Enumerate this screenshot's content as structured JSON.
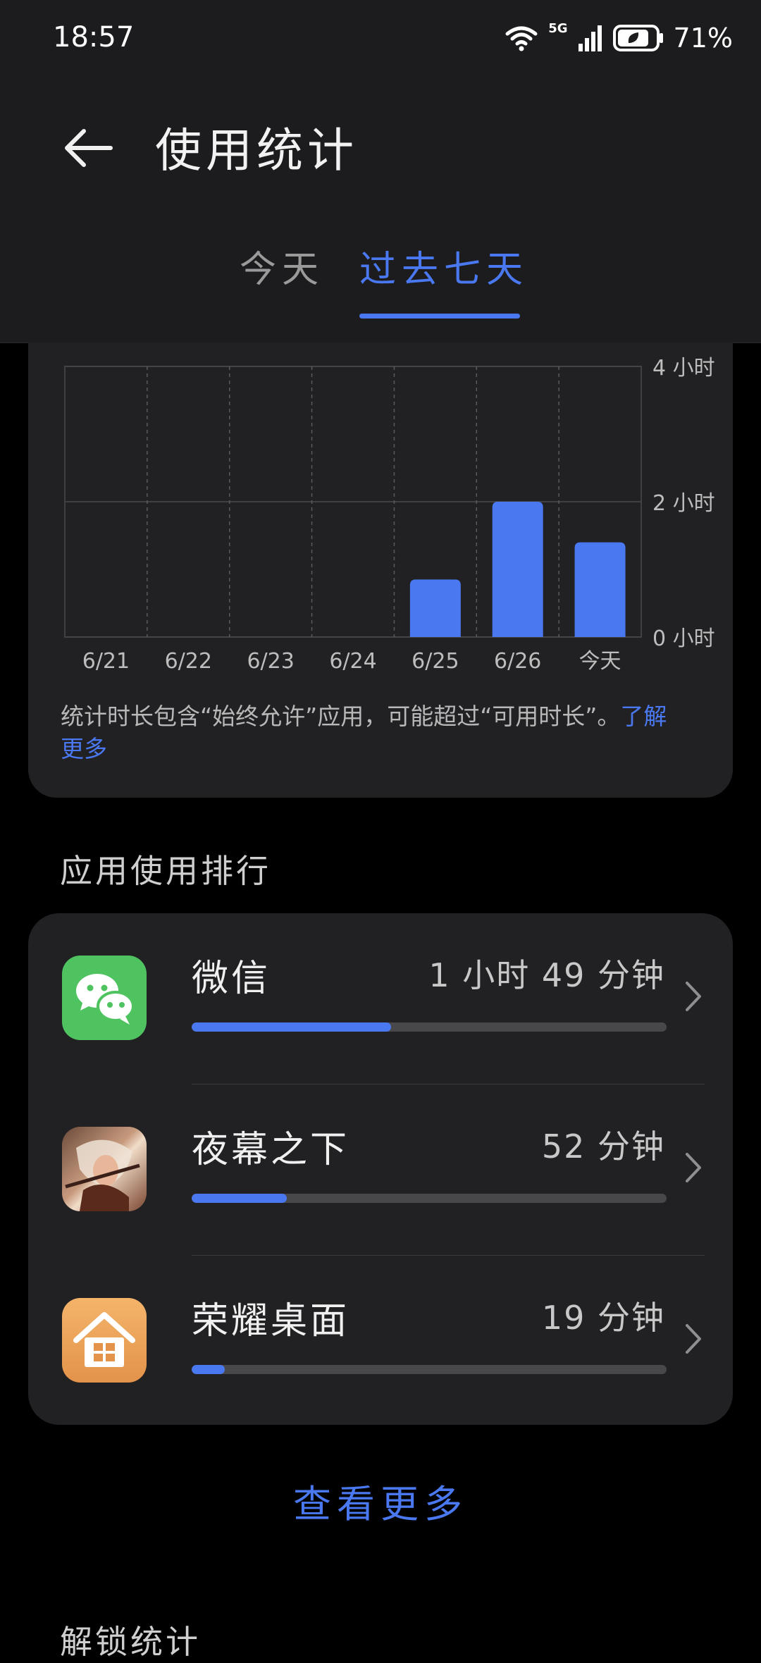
{
  "status_bar": {
    "time": "18:57",
    "network": "5G",
    "battery": "71%"
  },
  "header": {
    "title": "使用统计"
  },
  "tabs": [
    {
      "label": "今天",
      "selected": false
    },
    {
      "label": "过去七天",
      "selected": true
    }
  ],
  "chart_data": {
    "type": "bar",
    "categories": [
      "6/21",
      "6/22",
      "6/23",
      "6/24",
      "6/25",
      "6/26",
      "今天"
    ],
    "values": [
      0,
      0,
      0,
      0,
      0.85,
      2.0,
      1.4
    ],
    "ylim": [
      0,
      4
    ],
    "y_ticks": [
      {
        "value": 0,
        "label": "0 小时"
      },
      {
        "value": 2,
        "label": "2 小时"
      },
      {
        "value": 4,
        "label": "4 小时"
      }
    ],
    "bar_color": "#4a78f0",
    "grid": true
  },
  "note": {
    "text": "统计时长包含“始终允许”应用，可能超过“可用时长”。",
    "link": "了解更多"
  },
  "ranking": {
    "title": "应用使用排行",
    "apps": [
      {
        "name": "微信",
        "time": "1 小时 49 分钟",
        "progress": 0.42,
        "icon": "wechat-icon"
      },
      {
        "name": "夜幕之下",
        "time": "52 分钟",
        "progress": 0.2,
        "icon": "game-avatar-icon"
      },
      {
        "name": "荣耀桌面",
        "time": "19 分钟",
        "progress": 0.07,
        "icon": "home-icon"
      }
    ],
    "see_more": "查看更多"
  },
  "unlock_section": {
    "title": "解锁统计"
  },
  "colors": {
    "accent": "#4a78f0",
    "card": "#212123",
    "background": "#000000"
  }
}
